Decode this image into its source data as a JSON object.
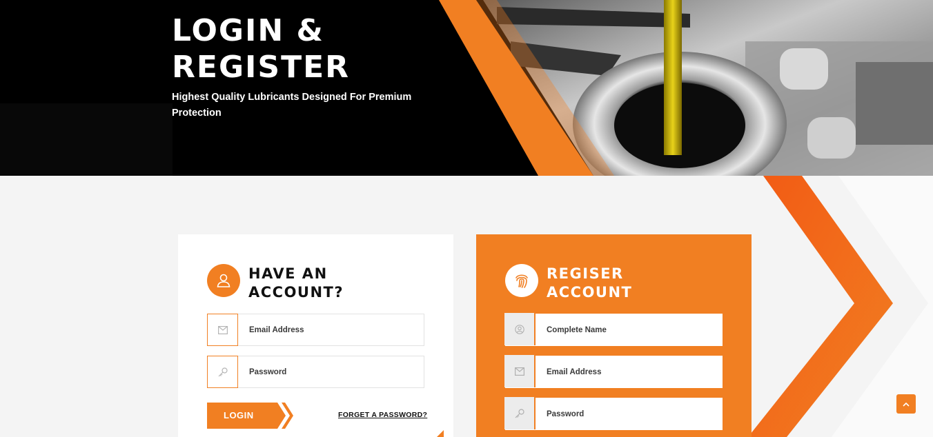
{
  "hero": {
    "title": "LOGIN & REGISTER",
    "subtitle": "Highest Quality Lubricants Designed For Premium Protection"
  },
  "login": {
    "heading": "HAVE AN ACCOUNT?",
    "heading_icon": "user-icon",
    "email_placeholder": "Email Address",
    "password_placeholder": "Password",
    "button_label": "LOGIN",
    "forget_label": "FORGET A PASSWORD?"
  },
  "register": {
    "heading": "REGISER ACCOUNT",
    "heading_icon": "fingerprint-icon",
    "name_placeholder": "Complete Name",
    "email_placeholder": "Email Address",
    "password_placeholder": "Password"
  },
  "colors": {
    "accent": "#f17f22",
    "accent_dark": "#f25a14",
    "hero_bg": "#000000"
  }
}
